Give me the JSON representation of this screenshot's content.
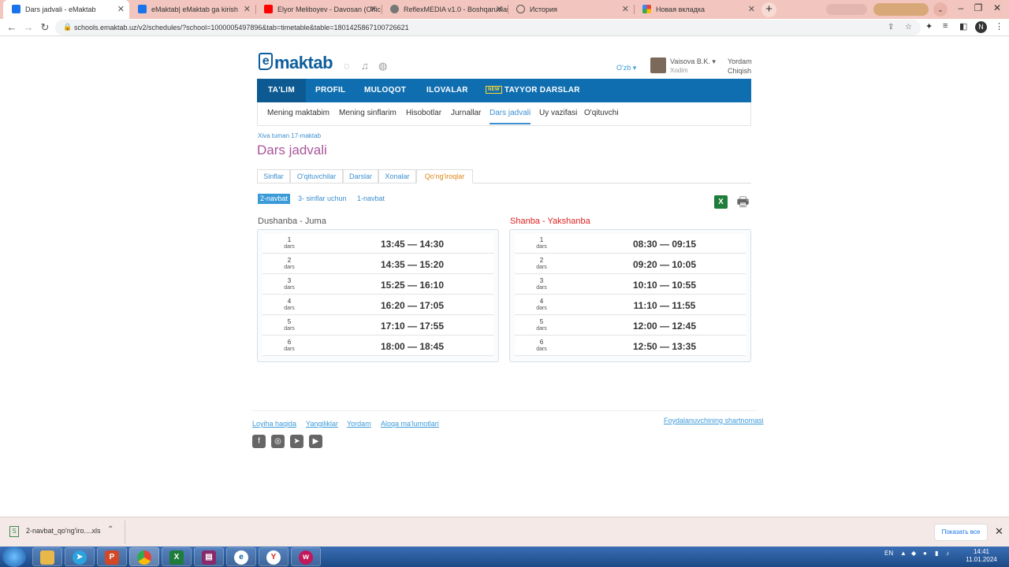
{
  "browser": {
    "tabs": [
      {
        "title": "Dars jadvali - eMaktab",
        "color": "#1a73e8"
      },
      {
        "title": "eMaktab| eMaktab ga kirish",
        "color": "#1a73e8"
      },
      {
        "title": "Elyor Meliboyev - Davosan (Offic",
        "color": "#ff0000"
      },
      {
        "title": "ReflexMEDIA v1.0 - Boshqaruvlar",
        "color": "#777777"
      },
      {
        "title": "История",
        "color": "#555555"
      },
      {
        "title": "Новая вкладка",
        "color": "#4285f4"
      }
    ],
    "url": "schools.emaktab.uz/v2/schedules/?school=1000005497896&tab=timetable&table=1801425867100726621",
    "profile_initial": "N"
  },
  "header": {
    "logo_text": "maktab",
    "logo_letter": "e",
    "language": "O'zb",
    "user_name": "Vaisova B.K.",
    "user_role": "Xodim",
    "help_link": "Yordam",
    "logout_link": "Chiqish"
  },
  "main_nav": {
    "items": [
      "TA'LIM",
      "PROFIL",
      "MULOQOT",
      "ILOVALAR",
      "TAYYOR DARSLAR"
    ],
    "new_badge": "NEW"
  },
  "sub_nav": {
    "items": [
      "Mening maktabim",
      "Mening sinflarim",
      "Hisobotlar",
      "Jurnallar",
      "Dars jadvali",
      "Uy vazifasi",
      "O'qituvchi"
    ],
    "active": "Dars jadvali"
  },
  "breadcrumb": "Xiva tuman 17-maktab",
  "page_title": "Dars jadvali",
  "filter_tabs": [
    "Sinflar",
    "O'qituvchilar",
    "Darslar",
    "Xonalar",
    "Qo'ng'iroqlar"
  ],
  "shifts": [
    "2-navbat",
    "3- sinflar uchun",
    "1-navbat"
  ],
  "lesson_word": "dars",
  "weekdays": {
    "title": "Dushanba - Juma",
    "lessons": [
      {
        "num": "1",
        "time": "13:45 — 14:30"
      },
      {
        "num": "2",
        "time": "14:35 — 15:20"
      },
      {
        "num": "3",
        "time": "15:25 — 16:10"
      },
      {
        "num": "4",
        "time": "16:20 — 17:05"
      },
      {
        "num": "5",
        "time": "17:10 — 17:55"
      },
      {
        "num": "6",
        "time": "18:00 — 18:45"
      }
    ]
  },
  "weekend": {
    "title": "Shanba - Yakshanba",
    "lessons": [
      {
        "num": "1",
        "time": "08:30 — 09:15"
      },
      {
        "num": "2",
        "time": "09:20 — 10:05"
      },
      {
        "num": "3",
        "time": "10:10 — 10:55"
      },
      {
        "num": "4",
        "time": "11:10 — 11:55"
      },
      {
        "num": "5",
        "time": "12:00 — 12:45"
      },
      {
        "num": "6",
        "time": "12:50 — 13:35"
      }
    ]
  },
  "footer": {
    "links": [
      "Loyiha haqida",
      "Yangiliklar",
      "Yordam",
      "Aloqa ma'lumotlari"
    ],
    "terms": "Foydalanuvchining shartnomasi",
    "social": [
      "facebook-icon",
      "instagram-icon",
      "telegram-icon",
      "youtube-icon"
    ]
  },
  "downloads": {
    "file_name": "2-navbat_qo'ng'iro....xls",
    "show_all": "Показать все"
  },
  "taskbar": {
    "language": "EN",
    "time": "14:41",
    "date": "11.01.2024"
  },
  "colors": {
    "nav_blue": "#0f6eb0",
    "title_purple": "#a8569a",
    "link_blue": "#3b8fd0",
    "active_orange": "#e0861a",
    "weekend_red": "#e02020"
  }
}
